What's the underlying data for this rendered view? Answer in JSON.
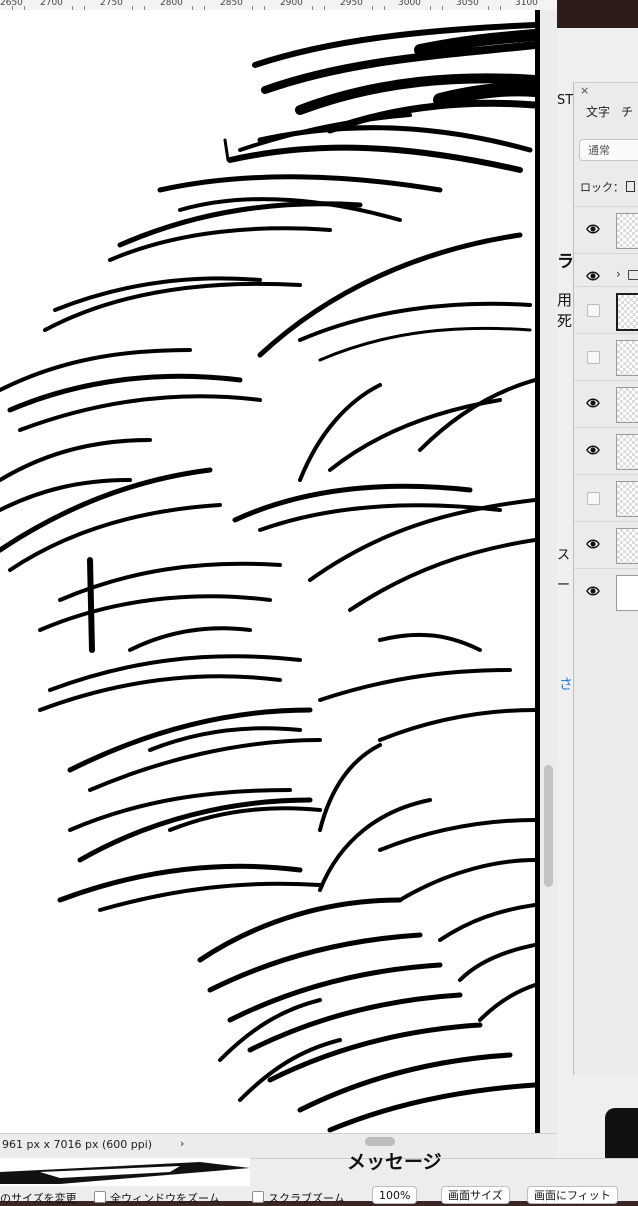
{
  "ruler": {
    "labels": [
      "2650",
      "2700",
      "2750",
      "2800",
      "2850",
      "2900",
      "2950",
      "3000",
      "3050",
      "3100"
    ]
  },
  "status": {
    "dimensions": "961 px x 7016 px (600 ppi)",
    "arrow": "›"
  },
  "layer_panel": {
    "close": "×",
    "tabs": [
      "文字",
      "チ"
    ],
    "blend_mode": "通常",
    "lock_label": "ロック：",
    "layers": [
      {
        "visible": true,
        "type": "layer"
      },
      {
        "visible": true,
        "type": "folder"
      },
      {
        "visible": false,
        "type": "layer",
        "selected": true
      },
      {
        "visible": false,
        "type": "layer"
      },
      {
        "visible": true,
        "type": "layer"
      },
      {
        "visible": true,
        "type": "layer"
      },
      {
        "visible": false,
        "type": "layer"
      },
      {
        "visible": true,
        "type": "layer"
      },
      {
        "visible": true,
        "type": "background"
      }
    ]
  },
  "background_dialog": {
    "st_label": "ST",
    "heading_char": "ラ",
    "line1": "用",
    "line2": "死",
    "side_char1": "ス",
    "side_char2": "ー",
    "link_char": "さ"
  },
  "bottom_bar": {
    "message": "メッセージ",
    "resize_label": "のサイズを変更",
    "all_windows_zoom": "全ウィンドウをズーム",
    "scrubby_zoom": "スクラブズーム",
    "zoom_value": "100%",
    "screen_size": "画面サイズ",
    "fit_screen": "画面にフィット"
  },
  "colors": {
    "accent_link": "#2a7ed3",
    "canvas_bg": "#ffffff",
    "ink": "#000000",
    "panel_bg": "#ebebeb"
  }
}
